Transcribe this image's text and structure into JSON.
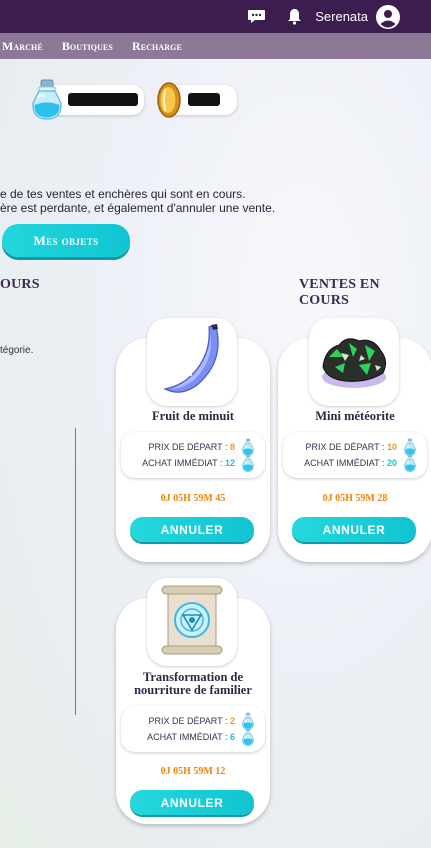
{
  "header": {
    "username": "Serenata",
    "icons": [
      "chat-icon",
      "bell-icon",
      "user-avatar-icon"
    ]
  },
  "nav": {
    "items": [
      "Marché",
      "Boutiques",
      "Recharge"
    ]
  },
  "currency": {
    "icons": [
      "potion-bottle-icon",
      "gold-coin-icon"
    ]
  },
  "intro": {
    "line1": "e de tes ventes et enchères qui sont en cours.",
    "line2": "ère est perdante, et également d'annuler une vente."
  },
  "buttons": {
    "mes_objets": "Mes objets"
  },
  "sections": {
    "left_title": "OURS",
    "left_text": "tégorie.",
    "right_title": "VENTES EN COURS"
  },
  "sales": [
    {
      "name_lines": [
        "Fruit de minuit"
      ],
      "start_label": "PRIX DE DÉPART : ",
      "start_price": "8",
      "buy_label": "ACHAT IMMÉDIAT : ",
      "buy_price": "12",
      "timer": "0J 05H 59M 45",
      "cancel": "ANNULER",
      "icon": "blue-banana-icon"
    },
    {
      "name_lines": [
        "Mini météorite"
      ],
      "start_label": "PRIX DE DÉPART : ",
      "start_price": "10",
      "buy_label": "ACHAT IMMÉDIAT : ",
      "buy_price": "20",
      "timer": "0J 05H 59M 28",
      "cancel": "ANNULER",
      "icon": "meteorite-icon"
    },
    {
      "name_lines": [
        "Transformation de",
        "nourriture de familier"
      ],
      "start_label": "PRIX DE DÉPART : ",
      "start_price": "2",
      "buy_label": "ACHAT IMMÉDIAT : ",
      "buy_price": "6",
      "timer": "0J 05H 59M 12",
      "cancel": "ANNULER",
      "icon": "magic-scroll-icon"
    }
  ]
}
